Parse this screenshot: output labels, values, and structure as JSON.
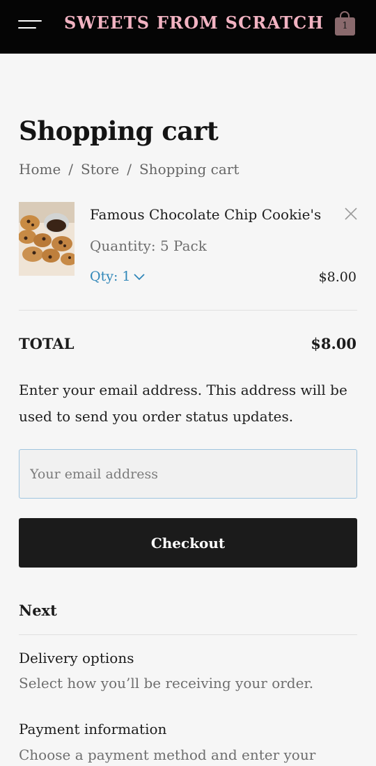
{
  "header": {
    "brand": "SWEETS FROM SCRATCH",
    "menu_icon": "hamburger-menu-icon",
    "cart_icon": "shopping-bag-icon",
    "cart_count": "1",
    "brand_color": "#f2b3c2"
  },
  "page": {
    "title": "Shopping cart",
    "breadcrumb": [
      "Home",
      "Store",
      "Shopping cart"
    ],
    "breadcrumb_separator": "/"
  },
  "cart": {
    "items": [
      {
        "name": "Famous Chocolate Chip Cookie's",
        "variant": "Quantity: 5 Pack",
        "qty_label": "Qty: 1",
        "price": "$8.00"
      }
    ],
    "total_label": "TOTAL",
    "total_value": "$8.00"
  },
  "checkout": {
    "email_note": "Enter your email address. This address will be used to send you order status updates.",
    "email_placeholder": "Your email address",
    "email_value": "",
    "button_label": "Checkout"
  },
  "next": {
    "heading": "Next",
    "steps": [
      {
        "title": "Delivery options",
        "description": "Select how you’ll be receiving your order."
      },
      {
        "title": "Payment information",
        "description": "Choose a payment method and enter your"
      }
    ]
  }
}
